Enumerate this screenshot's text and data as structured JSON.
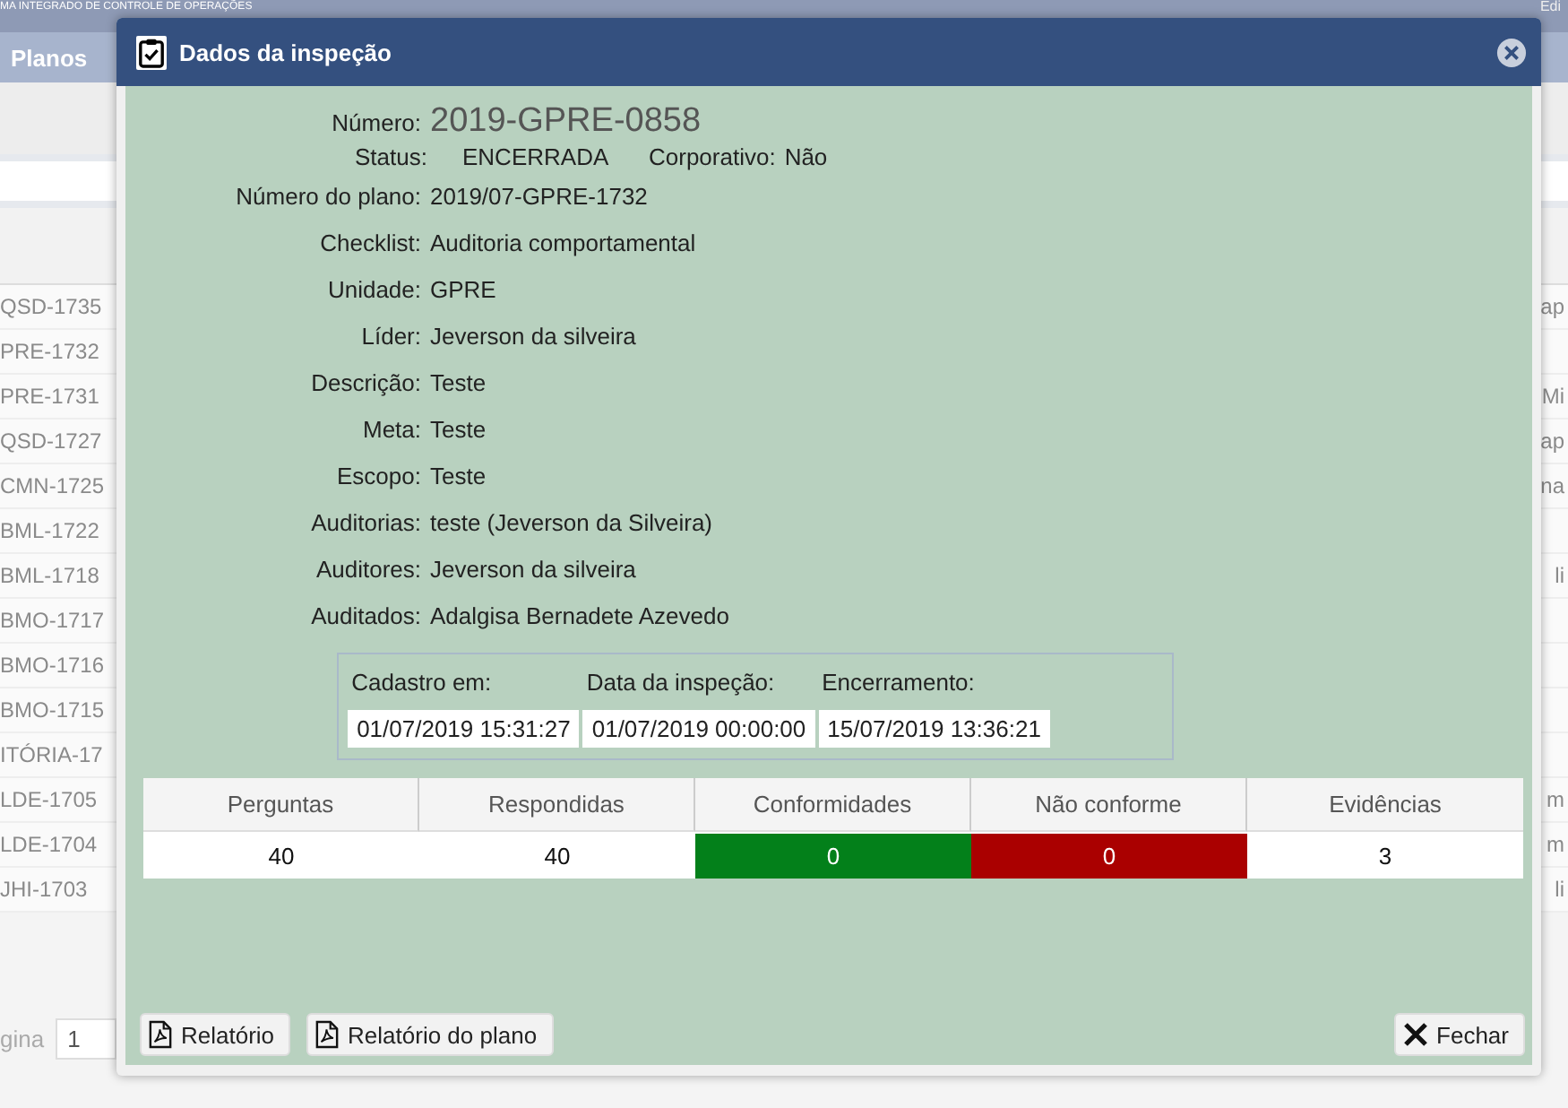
{
  "background": {
    "app_title": "MA INTEGRADO DE CONTROLE DE OPERAÇÕES",
    "user": "Edi",
    "nav_tab": "Planos",
    "rows": [
      {
        "code": "QSD-1735",
        "column_2": "ap"
      },
      {
        "code": "PRE-1732"
      },
      {
        "code": "PRE-1731",
        "column_2": "Mi"
      },
      {
        "code": "QSD-1727",
        "column_2": "ap"
      },
      {
        "code": "CMN-1725",
        "column_2": "na"
      },
      {
        "code": "BML-1722"
      },
      {
        "code": "BML-1718",
        "column_2": "li"
      },
      {
        "code": "BMO-1717"
      },
      {
        "code": "BMO-1716"
      },
      {
        "code": "BMO-1715"
      },
      {
        "code": "ITÓRIA-17"
      },
      {
        "code": "LDE-1705",
        "column_2": "m"
      },
      {
        "code": "LDE-1704",
        "column_2": "m"
      },
      {
        "code": "JHI-1703",
        "column_2": "li"
      }
    ],
    "pager": {
      "label": "gina",
      "value": "1"
    }
  },
  "dialog": {
    "title": "Dados da inspeção",
    "number": {
      "label": "Número:",
      "value": "2019-GPRE-0858"
    },
    "status": {
      "label": "Status:",
      "value": "ENCERRADA"
    },
    "corporate": {
      "label": "Corporativo:",
      "value": "Não"
    },
    "fields": [
      {
        "label": "Número do plano:",
        "value": "2019/07-GPRE-1732"
      },
      {
        "label": "Checklist:",
        "value": "Auditoria comportamental"
      },
      {
        "label": "Unidade:",
        "value": "GPRE"
      },
      {
        "label": "Líder:",
        "value": "Jeverson da silveira"
      },
      {
        "label": "Descrição:",
        "value": "Teste"
      },
      {
        "label": "Meta:",
        "value": "Teste"
      },
      {
        "label": "Escopo:",
        "value": "Teste"
      },
      {
        "label": "Auditorias:",
        "value": "teste (Jeverson da Silveira)"
      },
      {
        "label": "Auditores:",
        "value": "Jeverson da silveira"
      },
      {
        "label": "Auditados:",
        "value": "Adalgisa Bernadete Azevedo"
      }
    ],
    "dates": [
      {
        "label": "Cadastro em:",
        "value": "01/07/2019 15:31:27"
      },
      {
        "label": "Data da inspeção:",
        "value": "01/07/2019 00:00:00"
      },
      {
        "label": "Encerramento:",
        "value": "15/07/2019 13:36:21"
      }
    ],
    "stats": [
      {
        "label": "Perguntas",
        "value": "40",
        "kind": "plain"
      },
      {
        "label": "Respondidas",
        "value": "40",
        "kind": "plain"
      },
      {
        "label": "Conformidades",
        "value": "0",
        "kind": "good"
      },
      {
        "label": "Não conforme",
        "value": "0",
        "kind": "bad"
      },
      {
        "label": "Evidências",
        "value": "3",
        "kind": "plain"
      }
    ],
    "buttons": [
      {
        "label": "Relatório",
        "kind": "pdf"
      },
      {
        "label": "Relatório do plano",
        "kind": "pdf"
      }
    ],
    "close_button": {
      "label": "Fechar",
      "kind": "close"
    }
  }
}
